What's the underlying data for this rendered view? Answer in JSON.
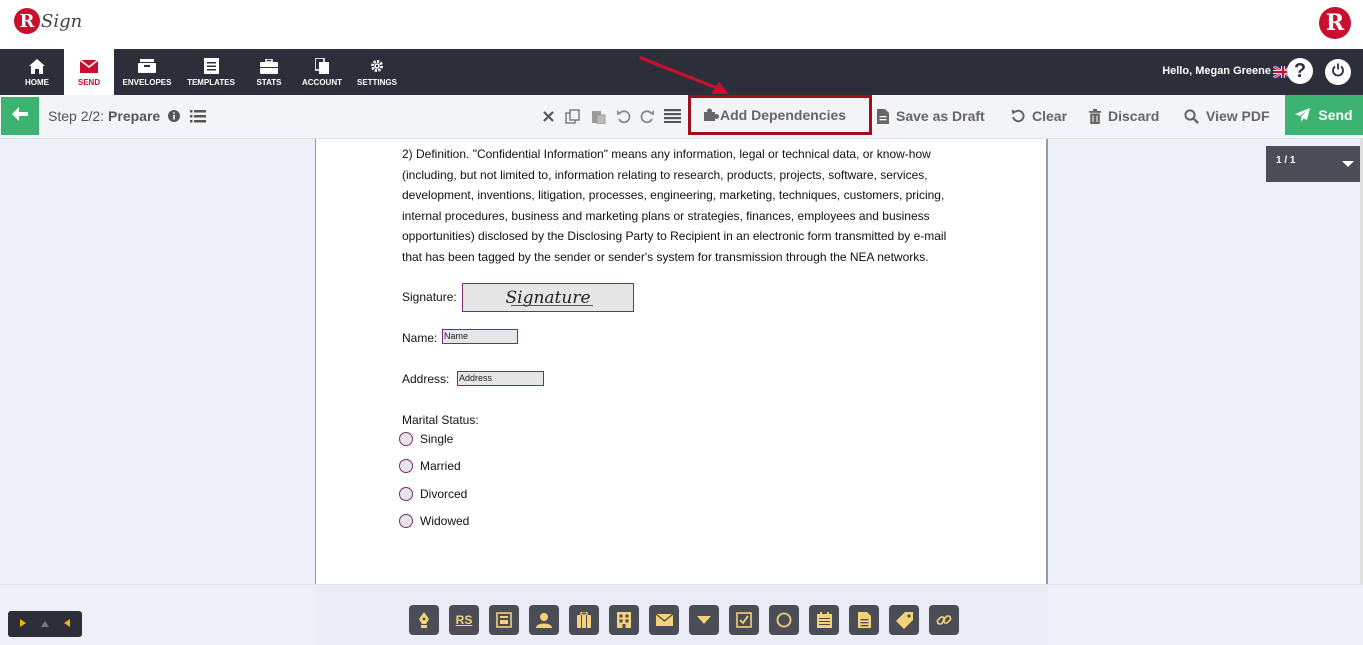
{
  "app": {
    "logo_text": "Sign",
    "logo_letter": "R"
  },
  "nav": {
    "items": [
      {
        "label": "HOME",
        "icon": "home-icon"
      },
      {
        "label": "SEND",
        "icon": "envelope-icon"
      },
      {
        "label": "ENVELOPES",
        "icon": "inbox-icon"
      },
      {
        "label": "TEMPLATES",
        "icon": "templates-icon"
      },
      {
        "label": "STATS",
        "icon": "briefcase-icon"
      },
      {
        "label": "ACCOUNT",
        "icon": "account-icon"
      },
      {
        "label": "SETTINGS",
        "icon": "gear-icon"
      }
    ],
    "active": "SEND",
    "greeting": "Hello, Megan Greene",
    "help_label": "?"
  },
  "toolbar": {
    "step_prefix": "Step 2/2:",
    "step_name": "Prepare",
    "add_dependencies": "Add Dependencies",
    "save_draft": "Save as Draft",
    "clear": "Clear",
    "discard": "Discard",
    "view_pdf": "View PDF",
    "send": "Send"
  },
  "document": {
    "paragraph_lines": [
      "2) Definition.  \"Confidential Information\" means any information, legal or technical data, or know-how",
      "(including, but not limited to, information relating to research, products, projects, software, services,",
      "development, inventions, litigation, processes, engineering, marketing, techniques, customers, pricing,",
      "internal procedures, business and marketing plans or strategies, finances, employees and business",
      "opportunities) disclosed by the Disclosing Party to Recipient in an electronic form transmitted by e-mail",
      "that has been tagged by the sender or sender's system for transmission through the NEA networks."
    ],
    "signature_label": "Signature:",
    "signature_placeholder": "Signature",
    "name_label": "Name:",
    "name_field": "Name",
    "address_label": "Address:",
    "address_field": "Address",
    "marital_label": "Marital Status:",
    "marital_options": [
      "Single",
      "Married",
      "Divorced",
      "Widowed"
    ]
  },
  "page_nav": {
    "page_indicator": "1 / 1"
  },
  "bottom_tools": [
    "pen-icon",
    "rs-initials-icon",
    "date-stamp-icon",
    "user-icon",
    "clipboard-icon",
    "company-icon",
    "email-icon",
    "dropdown-icon",
    "checkbox-icon",
    "radio-icon",
    "calendar-icon",
    "text-icon",
    "label-icon",
    "hyperlink-icon"
  ],
  "bottom_rs_label": "RS",
  "colors": {
    "brand_red": "#c8102e",
    "nav_dark": "#2c2f3a",
    "send_green": "#3cb371",
    "highlight_red": "#a00e1e",
    "tool_gold": "#f5d27a"
  }
}
